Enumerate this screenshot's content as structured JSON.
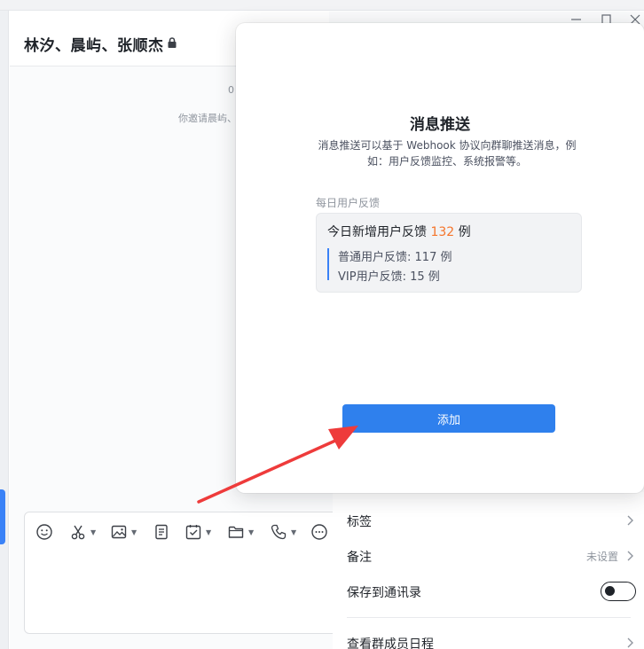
{
  "chat": {
    "title": "林汐、晨屿、张顺杰",
    "time_text": "0",
    "system_text": "你邀请晨屿、"
  },
  "modal": {
    "title": "消息推送",
    "description": "消息推送可以基于 Webhook 协议向群聊推送消息，例如：用户反馈监控、系统报警等。",
    "section_label": "每日用户反馈",
    "preview": {
      "head_prefix": "今日新增用户反馈",
      "head_count": "132",
      "head_suffix": "例",
      "line1_label": "普通用户反馈:",
      "line1_value": "117 例",
      "line2_label": "VIP用户反馈:",
      "line2_value": "15 例"
    },
    "add_label": "添加"
  },
  "settings": {
    "tags_label": "标签",
    "notes_label": "备注",
    "notes_value": "未设置",
    "save_contacts_label": "保存到通讯录",
    "save_contacts_on": false,
    "schedule_label": "查看群成员日程"
  },
  "colors": {
    "accent": "#2f80ed",
    "highlight_number": "#f5752b",
    "annotation_arrow": "#ee3b3b"
  }
}
